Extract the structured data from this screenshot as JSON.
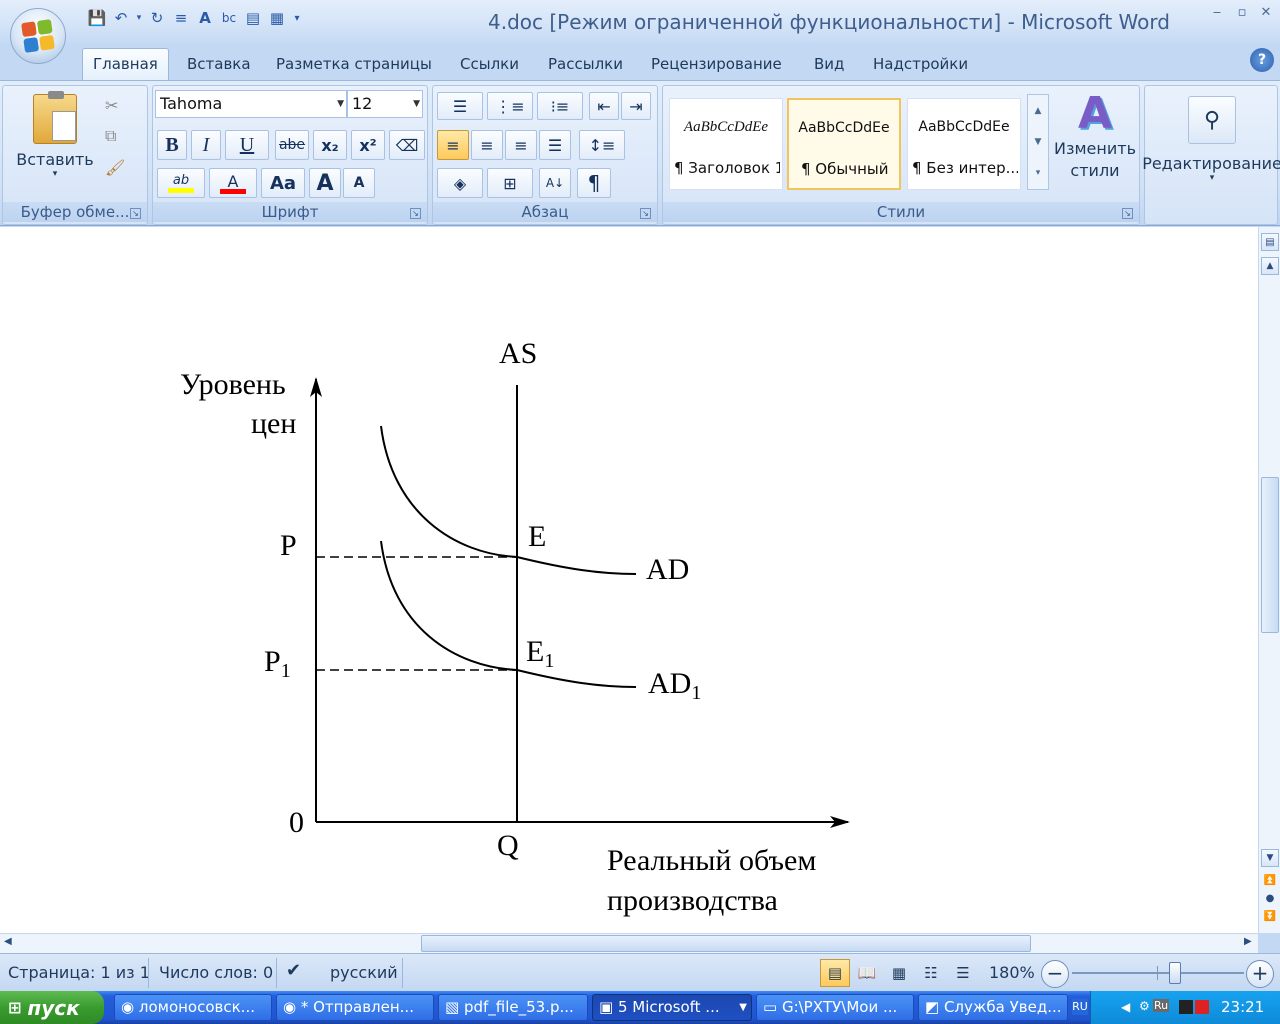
{
  "window": {
    "title": "4.doc [Режим ограниченной функциональности] - Microsoft Word",
    "controls": {
      "minimize": "‒",
      "restore": "▫",
      "close": "✕"
    }
  },
  "ribbon": {
    "tabs": [
      "Главная",
      "Вставка",
      "Разметка страницы",
      "Ссылки",
      "Рассылки",
      "Рецензирование",
      "Вид",
      "Надстройки"
    ],
    "clipboard": {
      "paste_label": "Вставить",
      "group_label": "Буфер обме..."
    },
    "font": {
      "family": "Tahoma",
      "size": "12",
      "group_label": "Шрифт",
      "bold": "B",
      "italic": "I",
      "underline": "U",
      "strike": "abe",
      "subscript": "x₂",
      "superscript": "x²",
      "highlight": "ab",
      "font_color": "A",
      "case": "Aa",
      "grow": "A",
      "shrink": "A",
      "highlight_color": "#ffff00",
      "font_color_value": "#ff0000"
    },
    "paragraph": {
      "group_label": "Абзац",
      "show_marks": "¶"
    },
    "styles": {
      "group_label": "Стили",
      "items": [
        {
          "sample": "AaBbCcDdEe",
          "name": "¶ Заголовок 1"
        },
        {
          "sample": "AaBbCcDdEe",
          "name": "¶ Обычный"
        },
        {
          "sample": "AaBbCcDdEe",
          "name": "¶ Без интер..."
        }
      ],
      "change_styles": "Изменить стили"
    },
    "editing": {
      "label": "Редактирование"
    }
  },
  "document": {
    "y_axis_label_line1": "Уровень",
    "y_axis_label_line2": "цен",
    "x_axis_label_line1": "Реальный объем",
    "x_axis_label_line2": "производства",
    "origin": "0",
    "as_label": "AS",
    "p_label": "P",
    "p1_label": "P",
    "p1_sub": "1",
    "e_label": "E",
    "e1_label": "E",
    "e1_sub": "1",
    "ad_label": "AD",
    "ad1_label": "AD",
    "ad1_sub": "1",
    "q_label": "Q"
  },
  "status": {
    "page": "Страница: 1 из 1",
    "words": "Число слов: 0",
    "language": "русский",
    "zoom": "180%",
    "zoom_level_percent": 180
  },
  "taskbar": {
    "start": "пуск",
    "tasks": [
      {
        "label": "ломоносовск...",
        "icon": "firefox-icon"
      },
      {
        "label": "* Отправлен...",
        "icon": "firefox-icon"
      },
      {
        "label": "pdf_file_53.p...",
        "icon": "pdf-icon"
      },
      {
        "label": "5 Microsoft ...",
        "icon": "word-icon"
      },
      {
        "label": "G:\\РХТУ\\Мои ...",
        "icon": "folder-icon"
      },
      {
        "label": "Служба Увед...",
        "icon": "antivirus-icon"
      }
    ],
    "lang": "RU",
    "tray_lang": "Ru",
    "clock": "23:21"
  }
}
